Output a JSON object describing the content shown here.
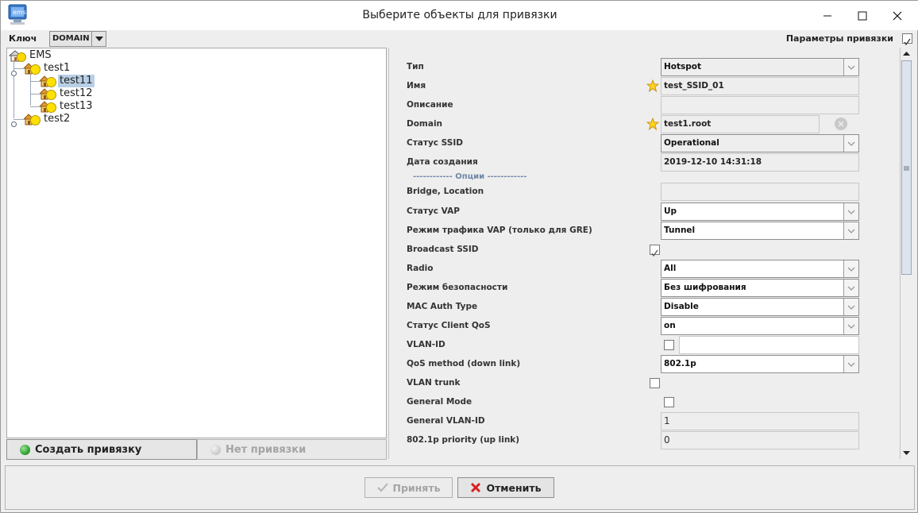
{
  "window": {
    "title": "Выберите объекты для привязки",
    "app_icon": "ems-app-icon"
  },
  "toolbar": {
    "key_label": "Ключ",
    "key_value": "DOMAIN",
    "params_label": "Параметры привязки",
    "params_checked": true
  },
  "tree": {
    "nodes": [
      {
        "label": "EMS",
        "icon": "home-icon",
        "level": 0
      },
      {
        "label": "test1",
        "icon": "domain-icon",
        "level": 1,
        "expanded": true
      },
      {
        "label": "test11",
        "icon": "domain-icon",
        "level": 2,
        "selected": true
      },
      {
        "label": "test12",
        "icon": "domain-icon",
        "level": 2
      },
      {
        "label": "test13",
        "icon": "domain-icon",
        "level": 2
      },
      {
        "label": "test2",
        "icon": "domain-icon",
        "level": 1,
        "expanded": false
      }
    ]
  },
  "actions": {
    "create_label": "Создать привязку",
    "create_color": "#2ea42e",
    "nolink_label": "Нет привязки"
  },
  "props": {
    "separator": "------------ Опции ------------",
    "rows": [
      {
        "label": "Тип",
        "kind": "combo",
        "value": "Hotspot",
        "grey": true
      },
      {
        "label": "Имя",
        "kind": "field",
        "value": "test_SSID_01",
        "star": true
      },
      {
        "label": "Описание",
        "kind": "field",
        "value": ""
      },
      {
        "label": "Domain",
        "kind": "field",
        "value": "test1.root",
        "star": true
      },
      {
        "label": "Статус SSID",
        "kind": "combo",
        "value": "Operational",
        "grey": true
      },
      {
        "label": "Дата создания",
        "kind": "field",
        "value": "2019-12-10 14:31:18"
      },
      {
        "label": "Bridge, Location",
        "kind": "field",
        "value": ""
      },
      {
        "label": "Статус VAP",
        "kind": "combo",
        "value": "Up"
      },
      {
        "label": "Режим трафика VAP (только для GRE)",
        "kind": "combo",
        "value": "Tunnel"
      },
      {
        "label": "Broadcast SSID",
        "kind": "check",
        "checked": true
      },
      {
        "label": "Radio",
        "kind": "combo",
        "value": "All"
      },
      {
        "label": "Режим безопасности",
        "kind": "combo",
        "value": "Без шифрования"
      },
      {
        "label": "MAC Auth Type",
        "kind": "combo",
        "value": "Disable"
      },
      {
        "label": "Статус Client QoS",
        "kind": "combo",
        "value": "on"
      },
      {
        "label": "VLAN-ID",
        "kind": "checkfield",
        "checked": false,
        "value": ""
      },
      {
        "label": "QoS method (down link)",
        "kind": "combo",
        "value": "802.1p"
      },
      {
        "label": "VLAN trunk",
        "kind": "check",
        "checked": false
      },
      {
        "label": "General Mode",
        "kind": "check",
        "checked": false
      },
      {
        "label": "General VLAN-ID",
        "kind": "field",
        "value": "1"
      },
      {
        "label": "802.1p priority (up link)",
        "kind": "field",
        "value": "0"
      }
    ]
  },
  "footer": {
    "ok_label": "Принять",
    "cancel_label": "Отменить",
    "cancel_icon_color": "#d82020"
  }
}
